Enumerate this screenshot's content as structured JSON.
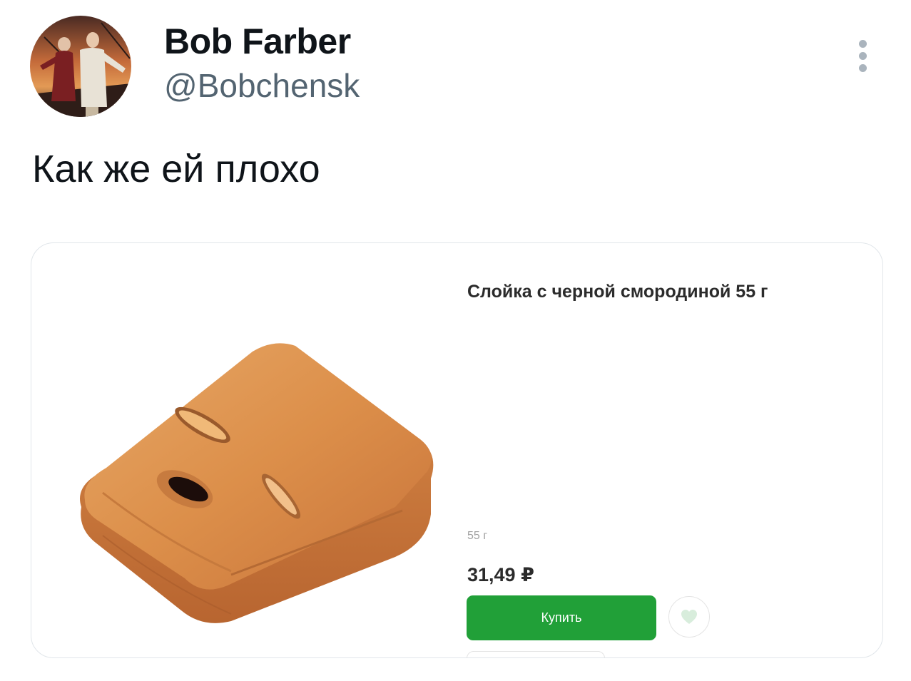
{
  "author": {
    "name": "Bob Farber",
    "handle": "@Bobchensk"
  },
  "more_icon": "more-vertical-icon",
  "tweet": {
    "text": "Как же ей плохо"
  },
  "media": {
    "product": {
      "title": "Слойка с черной смородиной 55 г",
      "weight": "55 г",
      "price": "31,49 ₽",
      "buy_label": "Купить",
      "favorite_icon": "heart-icon",
      "image": "puff-pastry-photo"
    }
  },
  "colors": {
    "buy_button": "#21a038",
    "handle_text": "#536471",
    "card_border": "#e1e6ea"
  }
}
